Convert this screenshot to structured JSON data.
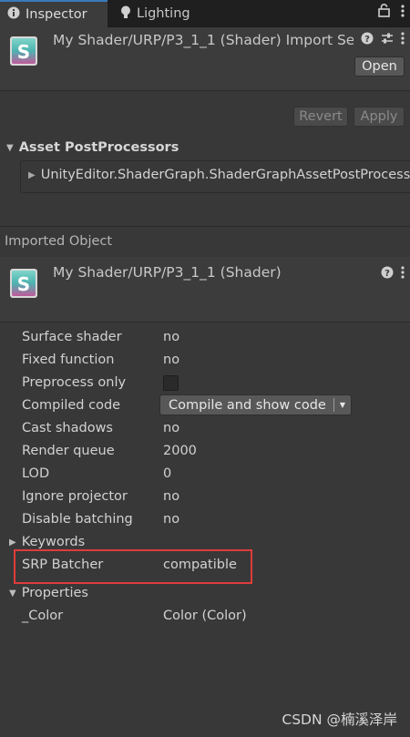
{
  "tabs": [
    {
      "label": "Inspector",
      "icon": "info-icon",
      "active": true
    },
    {
      "label": "Lighting",
      "icon": "lightbulb-icon",
      "active": false
    }
  ],
  "tabbar_icons": [
    "lock-icon",
    "more-icon"
  ],
  "header": {
    "title": "My Shader/URP/P3_1_1 (Shader) Import Se",
    "open_label": "Open"
  },
  "actions": {
    "revert_label": "Revert",
    "apply_label": "Apply"
  },
  "asset_postprocessors": {
    "label": "Asset PostProcessors",
    "items": [
      "UnityEditor.ShaderGraph.ShaderGraphAssetPostProcess"
    ]
  },
  "imported_object": {
    "label": "Imported Object",
    "title": "My Shader/URP/P3_1_1 (Shader)"
  },
  "properties": {
    "surface_shader": {
      "label": "Surface shader",
      "value": "no"
    },
    "fixed_function": {
      "label": "Fixed function",
      "value": "no"
    },
    "preprocess_only": {
      "label": "Preprocess only",
      "checked": false
    },
    "compiled_code": {
      "label": "Compiled code",
      "button": "Compile and show code"
    },
    "cast_shadows": {
      "label": "Cast shadows",
      "value": "no"
    },
    "render_queue": {
      "label": "Render queue",
      "value": "2000"
    },
    "lod": {
      "label": "LOD",
      "value": "0"
    },
    "ignore_projector": {
      "label": "Ignore projector",
      "value": "no"
    },
    "disable_batching": {
      "label": "Disable batching",
      "value": "no"
    },
    "keywords": {
      "label": "Keywords"
    },
    "srp_batcher": {
      "label": "SRP Batcher",
      "value": "compatible"
    },
    "properties_foldout": {
      "label": "Properties"
    },
    "color_prop": {
      "label": "_Color",
      "value": "Color (Color)"
    }
  },
  "watermark": "CSDN @楠溪泽岸",
  "colors": {
    "background": "#383838",
    "header": "#3c3c3c",
    "highlight": "#e03b3b",
    "tab_accent": "#3a79bb"
  }
}
